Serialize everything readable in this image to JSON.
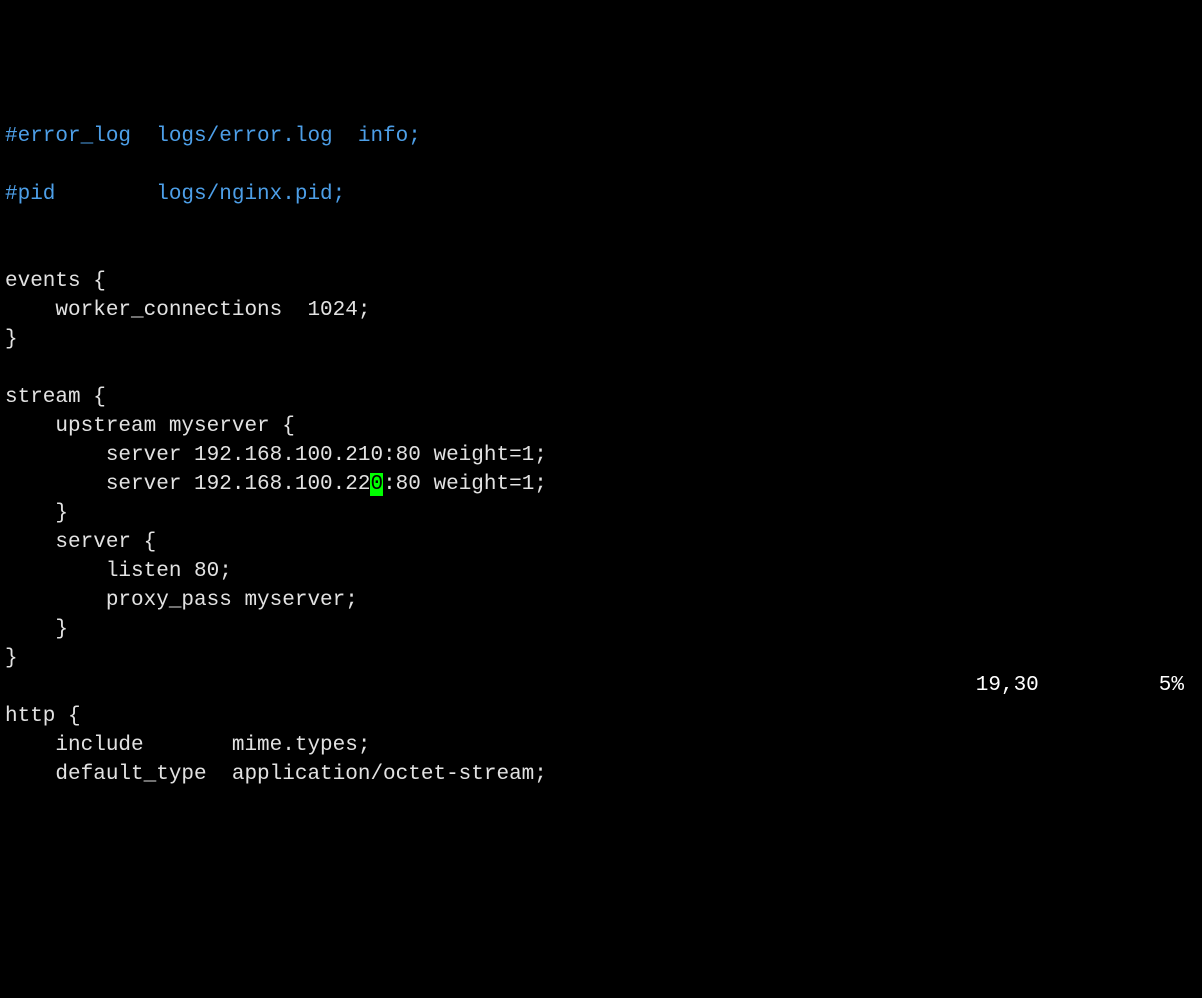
{
  "lines": {
    "l1_comment": "#error_log  logs/error.log  info;",
    "l2_empty": "",
    "l3_comment": "#pid        logs/nginx.pid;",
    "l4_empty": "",
    "l5_empty": "",
    "l6_events": "events {",
    "l7_worker": "    worker_connections  1024;",
    "l8_close": "}",
    "l9_empty": "",
    "l10_stream": "stream {",
    "l11_upstream": "    upstream myserver {",
    "l12_server1": "        server 192.168.100.210:80 weight=1;",
    "l13_server2_pre": "        server 192.168.100.22",
    "l13_cursor": "0",
    "l13_server2_post": ":80 weight=1;",
    "l14_close": "    }",
    "l15_server": "    server {",
    "l16_listen": "        listen 80;",
    "l17_proxy": "        proxy_pass myserver;",
    "l18_close": "    }",
    "l19_close": "}",
    "l20_empty": "",
    "l21_http": "http {",
    "l22_include": "    include       mime.types;",
    "l23_default": "    default_type  application/octet-stream;"
  },
  "status": {
    "position": "19,30",
    "percent": "5%"
  }
}
